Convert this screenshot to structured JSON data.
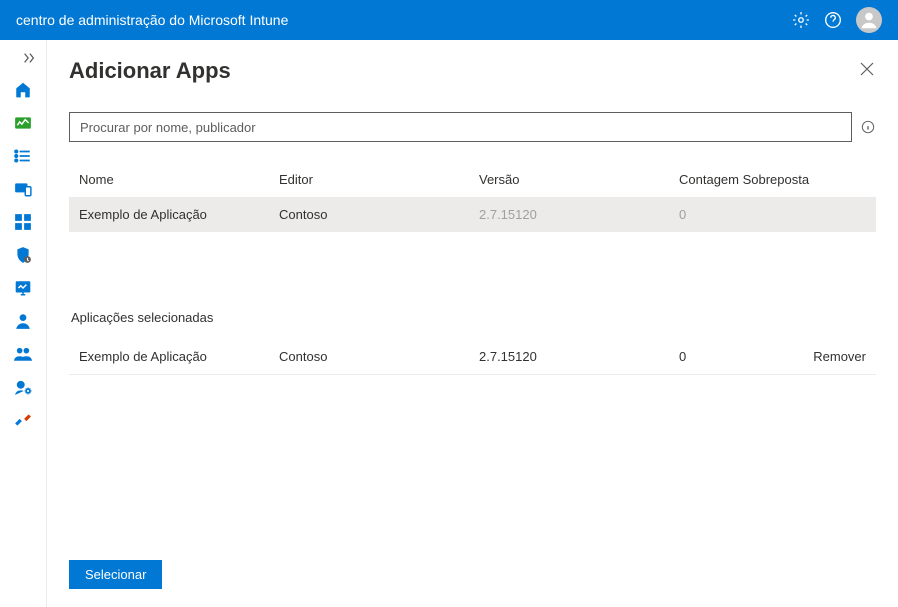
{
  "header": {
    "title": "centro de administração do Microsoft Intune"
  },
  "page": {
    "title": "Adicionar Apps",
    "searchPlaceholder": "Procurar por nome, publicador",
    "sectionSelected": "Aplicações selecionadas"
  },
  "table": {
    "headers": {
      "name": "Nome",
      "publisher": "Editor",
      "version": "Versão",
      "count": "Contagem Sobreposta"
    },
    "rows": [
      {
        "name": "Exemplo de Aplicação",
        "publisher": "Contoso",
        "version": "2.7.15120",
        "count": "0"
      }
    ]
  },
  "selected": {
    "rows": [
      {
        "name": "Exemplo de Aplicação",
        "publisher": "Contoso",
        "version": "2.7.15120",
        "count": "0",
        "action": "Remover"
      }
    ]
  },
  "footer": {
    "selectLabel": "Selecionar"
  }
}
